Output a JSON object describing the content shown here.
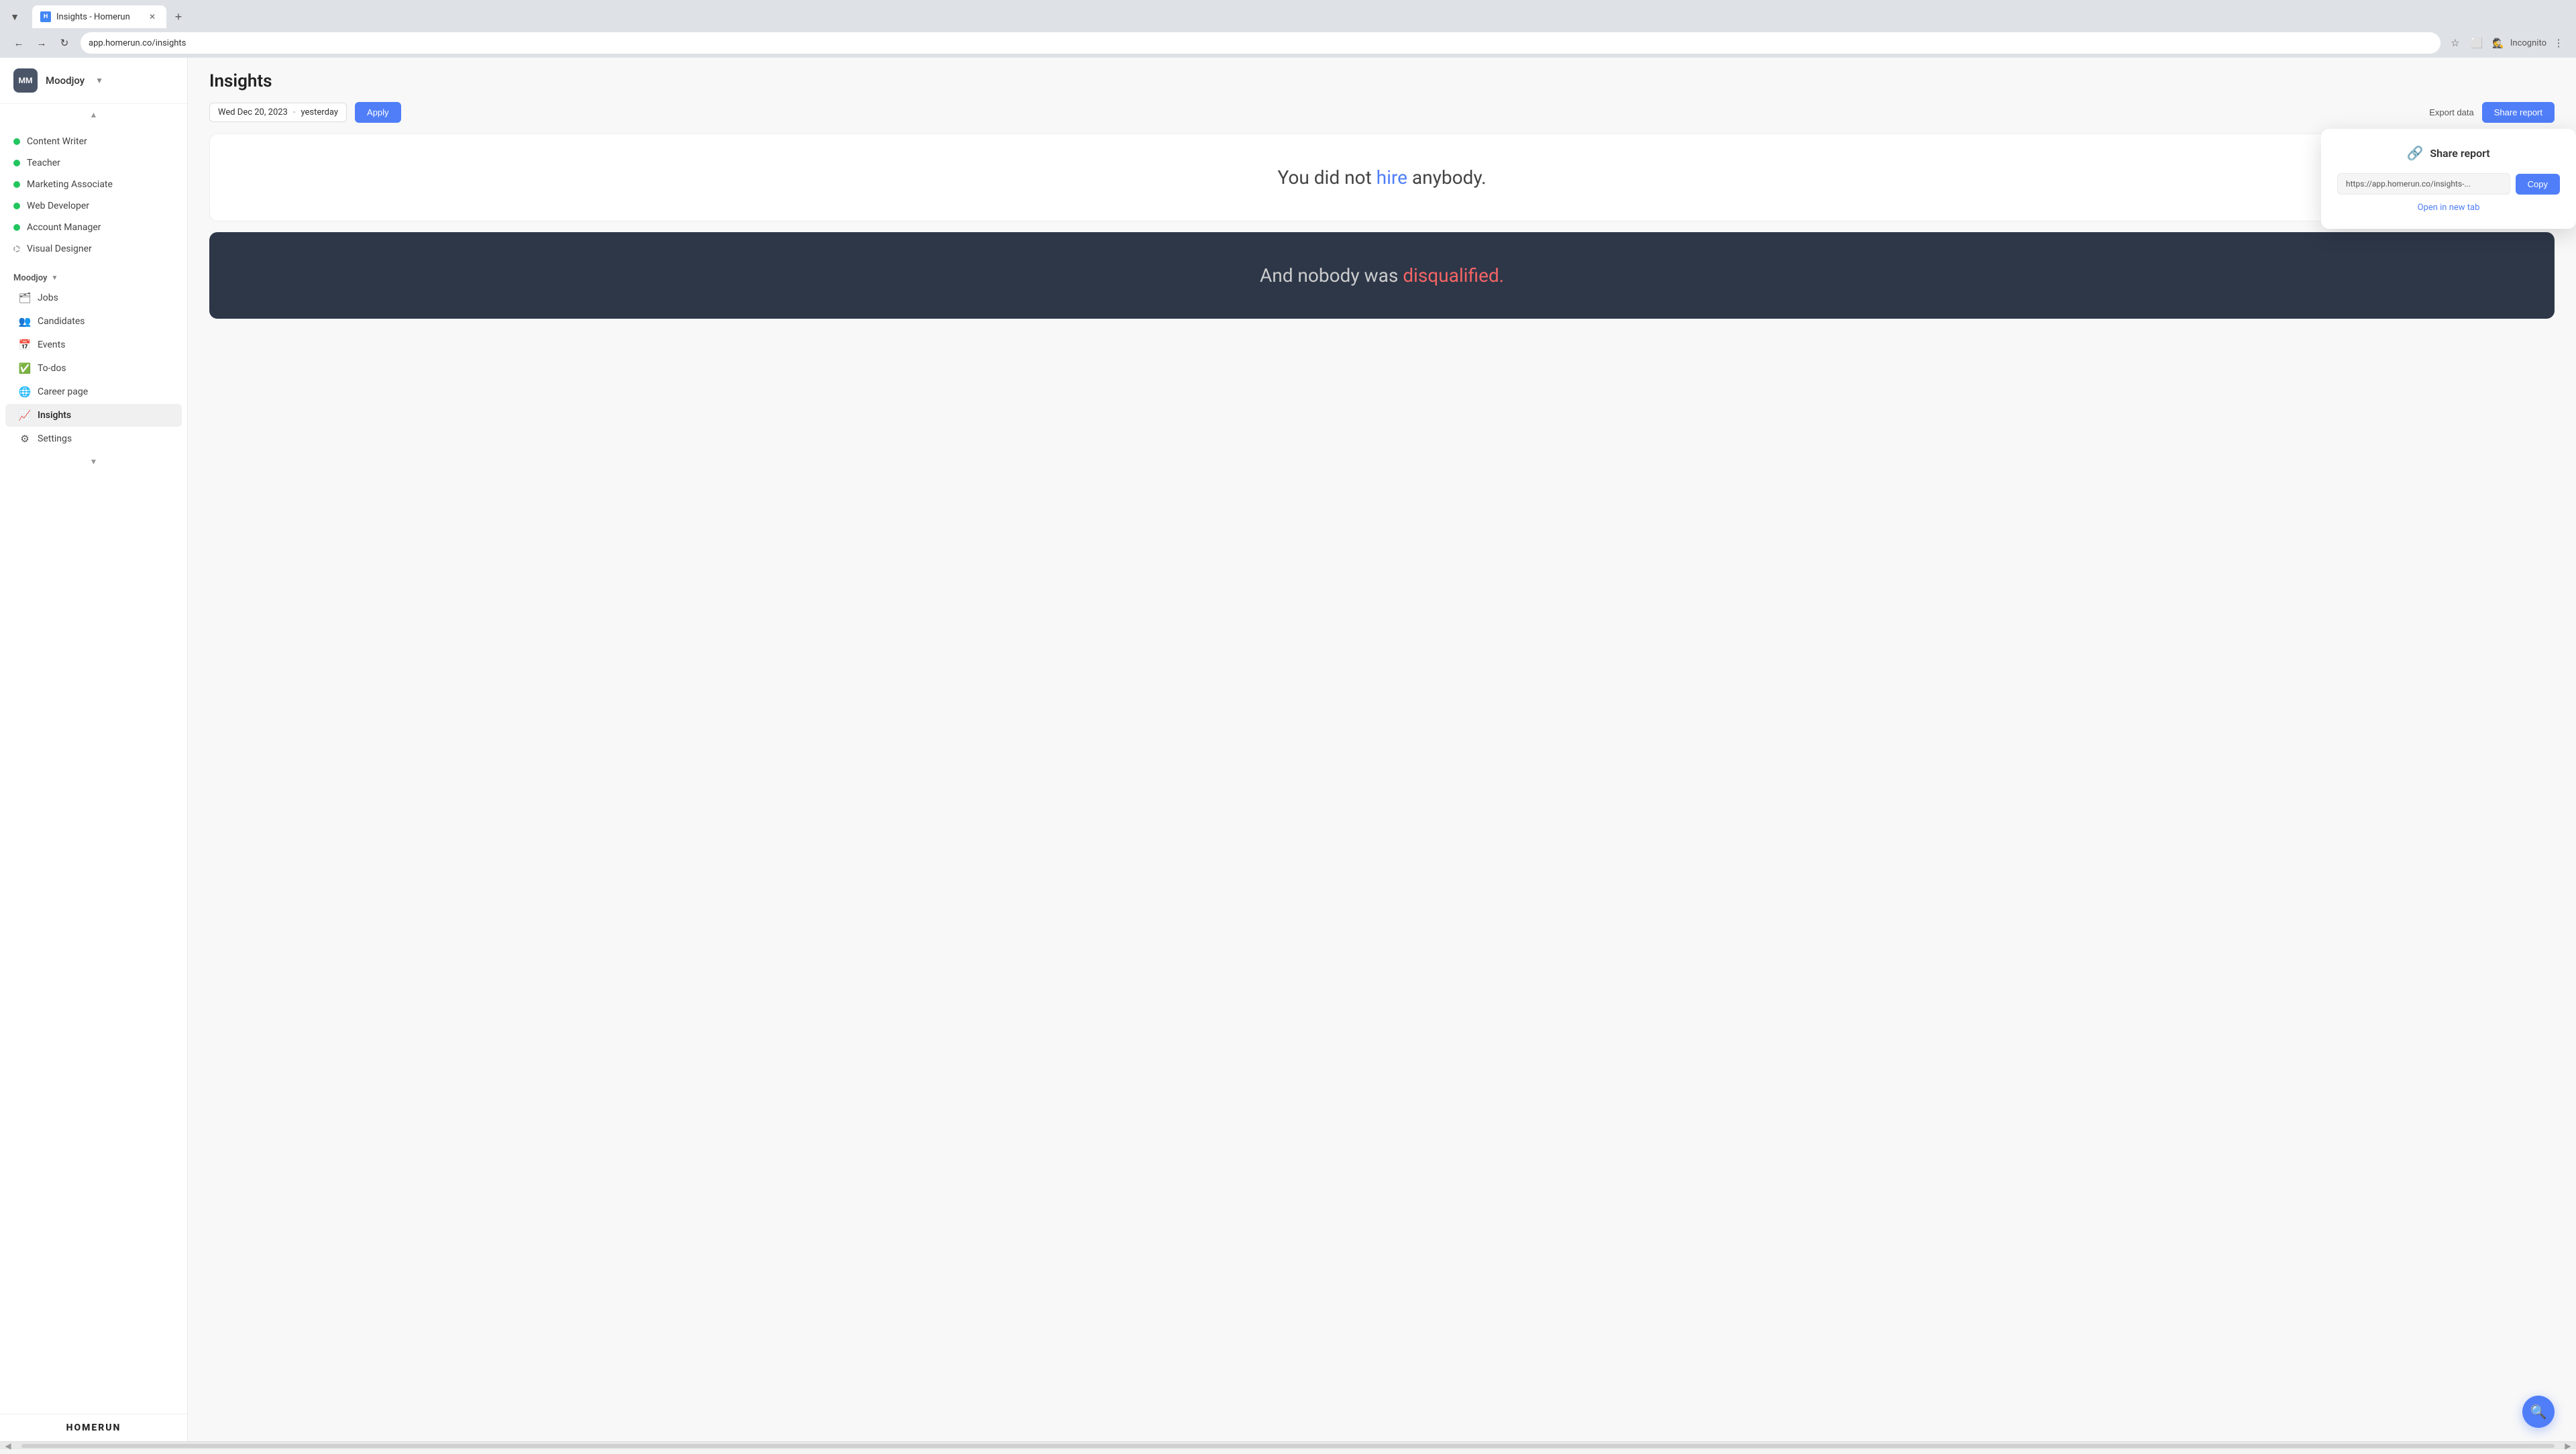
{
  "browser": {
    "tab_title": "Insights - Homerun",
    "tab_favicon": "H",
    "url": "app.homerun.co/insights",
    "incognito_label": "Incognito"
  },
  "sidebar": {
    "user_initials": "MM",
    "user_name": "Moodjoy",
    "jobs": [
      {
        "label": "Content Writer",
        "type": "green"
      },
      {
        "label": "Teacher",
        "type": "green"
      },
      {
        "label": "Marketing Associate",
        "type": "green"
      },
      {
        "label": "Web Developer",
        "type": "green"
      },
      {
        "label": "Account Manager",
        "type": "green"
      },
      {
        "label": "Visual Designer",
        "type": "dashed"
      }
    ],
    "section_label": "Moodjoy",
    "nav_items": [
      {
        "label": "Jobs",
        "icon": "🗂",
        "active": false
      },
      {
        "label": "Candidates",
        "icon": "👥",
        "active": false
      },
      {
        "label": "Events",
        "icon": "📅",
        "active": false
      },
      {
        "label": "To-dos",
        "icon": "✅",
        "active": false
      },
      {
        "label": "Career page",
        "icon": "🌐",
        "active": false
      },
      {
        "label": "Insights",
        "icon": "📈",
        "active": true
      },
      {
        "label": "Settings",
        "icon": "⚙",
        "active": false
      }
    ],
    "logo": "HOMERUN"
  },
  "main": {
    "page_title": "Insights",
    "toolbar": {
      "date_from": "Wed Dec 20, 2023",
      "date_sep": "-",
      "date_to": "yesterday",
      "apply_label": "Apply",
      "export_label": "Export data",
      "share_label": "Share report"
    },
    "share_popup": {
      "title": "Share report",
      "url": "https://app.homerun.co/insights-...",
      "copy_label": "Copy",
      "open_label": "Open in new tab"
    },
    "panels": [
      {
        "type": "light",
        "text_before": "You did not ",
        "highlight": "hire",
        "highlight_color": "#4f7ef8",
        "text_after": " anybody."
      },
      {
        "type": "dark",
        "text_before": "And nobody was ",
        "highlight": "disqualified.",
        "highlight_color": "#f56565",
        "text_after": ""
      }
    ]
  }
}
